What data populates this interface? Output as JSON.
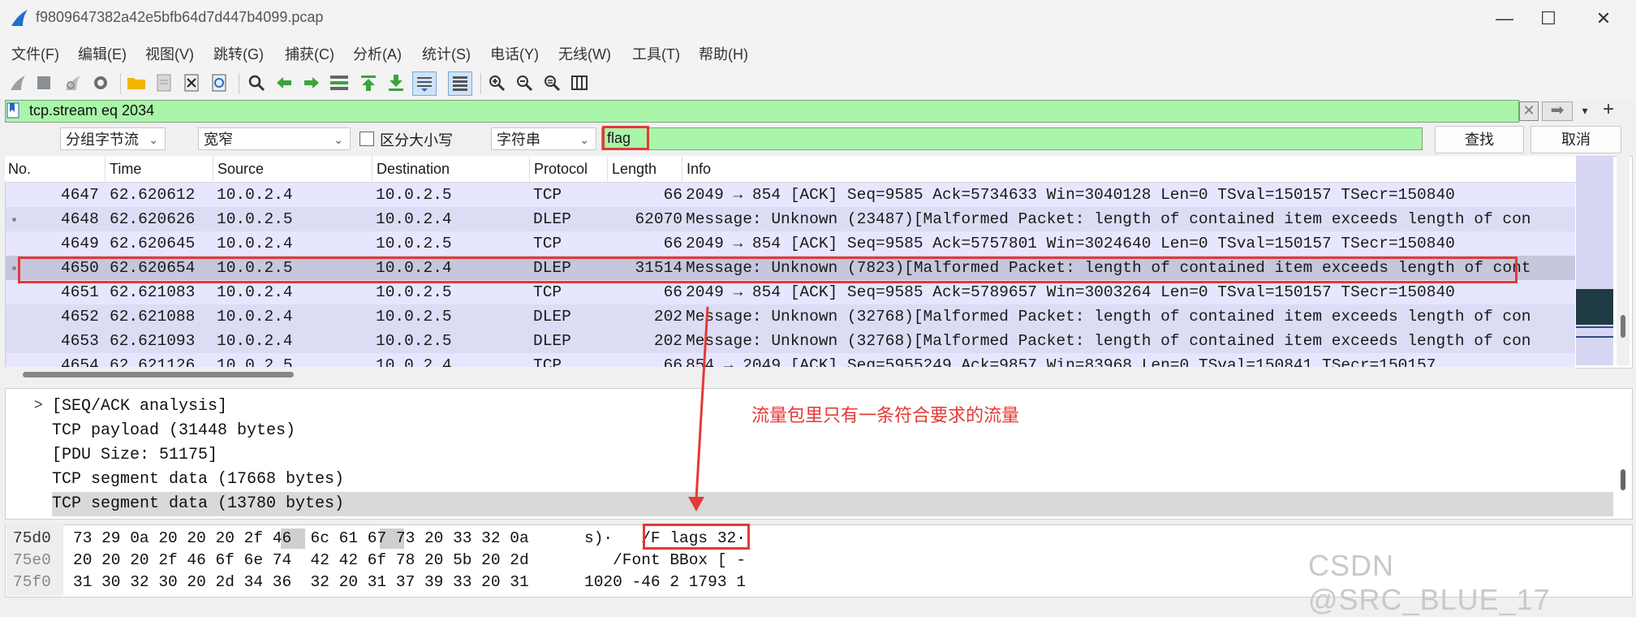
{
  "window": {
    "title": "f9809647382a42e5bfb64d7d447b4099.pcap",
    "minimize": "—",
    "maximize": "☐",
    "close": "✕"
  },
  "menu": [
    "文件(F)",
    "编辑(E)",
    "视图(V)",
    "跳转(G)",
    "捕获(C)",
    "分析(A)",
    "统计(S)",
    "电话(Y)",
    "无线(W)",
    "工具(T)",
    "帮助(H)"
  ],
  "toolbar_icons": [
    "shark-fin-start-icon",
    "stop-icon",
    "restart-icon",
    "options-gear-icon",
    "open-folder-icon",
    "save-file-icon",
    "close-file-icon",
    "reload-icon",
    "find-magnifier-icon",
    "go-back-icon",
    "go-forward-icon",
    "go-to-packet-icon",
    "first-packet-icon",
    "last-packet-icon",
    "autoscroll-icon",
    "colorize-icon",
    "zoom-in-icon",
    "zoom-out-icon",
    "zoom-reset-icon",
    "resize-columns-icon"
  ],
  "display_filter": {
    "value": "tcp.stream eq 2034",
    "color": "#a9f5a9"
  },
  "find_bar": {
    "search_in": "分组字节流",
    "char_width": "宽窄",
    "case_sensitive_label": "区分大小写",
    "search_type": "字符串",
    "search_text": "flag",
    "find_button": "查找",
    "cancel_button": "取消"
  },
  "packet_list": {
    "columns": [
      "No.",
      "Time",
      "Source",
      "Destination",
      "Protocol",
      "Length",
      "Info"
    ],
    "rows": [
      {
        "no": "4647",
        "time": "62.620612",
        "src": "10.0.2.4",
        "dst": "10.0.2.5",
        "proto": "TCP",
        "len": "66",
        "info": "2049 → 854 [ACK] Seq=9585 Ack=5734633 Win=3040128 Len=0 TSval=150157 TSecr=150840"
      },
      {
        "no": "4648",
        "time": "62.620626",
        "src": "10.0.2.5",
        "dst": "10.0.2.4",
        "proto": "DLEP",
        "len": "62070",
        "info": "Message: Unknown (23487)[Malformed Packet: length of contained item exceeds length of con"
      },
      {
        "no": "4649",
        "time": "62.620645",
        "src": "10.0.2.4",
        "dst": "10.0.2.5",
        "proto": "TCP",
        "len": "66",
        "info": "2049 → 854 [ACK] Seq=9585 Ack=5757801 Win=3024640 Len=0 TSval=150157 TSecr=150840"
      },
      {
        "no": "4650",
        "time": "62.620654",
        "src": "10.0.2.5",
        "dst": "10.0.2.4",
        "proto": "DLEP",
        "len": "31514",
        "info": "Message: Unknown (7823)[Malformed Packet: length of contained item exceeds length of cont"
      },
      {
        "no": "4651",
        "time": "62.621083",
        "src": "10.0.2.4",
        "dst": "10.0.2.5",
        "proto": "TCP",
        "len": "66",
        "info": "2049 → 854 [ACK] Seq=9585 Ack=5789657 Win=3003264 Len=0 TSval=150157 TSecr=150840"
      },
      {
        "no": "4652",
        "time": "62.621088",
        "src": "10.0.2.4",
        "dst": "10.0.2.5",
        "proto": "DLEP",
        "len": "202",
        "info": "Message: Unknown (32768)[Malformed Packet: length of contained item exceeds length of con"
      },
      {
        "no": "4653",
        "time": "62.621093",
        "src": "10.0.2.4",
        "dst": "10.0.2.5",
        "proto": "DLEP",
        "len": "202",
        "info": "Message: Unknown (32768)[Malformed Packet: length of contained item exceeds length of con"
      },
      {
        "no": "4654",
        "time": "62.621126",
        "src": "10.0.2.5",
        "dst": "10.0.2.4",
        "proto": "TCP",
        "len": "66",
        "info": "854 → 2049 [ACK] Seq=5955249 Ack=9857 Win=83968 Len=0 TSval=150841 TSecr=150157"
      }
    ]
  },
  "details": {
    "expander": ">",
    "lines": [
      "[SEQ/ACK analysis]",
      "TCP payload (31448 bytes)",
      "[PDU Size: 51175]",
      "TCP segment data (17668 bytes)",
      "TCP segment data (13780 bytes)"
    ]
  },
  "annotation": "流量包里只有一条符合要求的流量",
  "bytes": {
    "rows": [
      {
        "offset": "75d0",
        "hex": "73 29 0a 20 20 20 2f 46  6c 61 67 73 20 33 32 0a",
        "ascii": "s)·   /F lags 32·"
      },
      {
        "offset": "75e0",
        "hex": "20 20 20 2f 46 6f 6e 74  42 42 6f 78 20 5b 20 2d",
        "ascii": "   /Font BBox [ -"
      },
      {
        "offset": "75f0",
        "hex": "31 30 32 30 20 2d 34 36  32 20 31 37 39 33 20 31",
        "ascii": "1020 -46 2 1793 1"
      }
    ]
  },
  "watermark": "CSDN @SRC_BLUE_17",
  "colors": {
    "highlight_red": "#e53935",
    "tcp_row": "#e7e6ff",
    "dlep_row": "#dcdcf5",
    "selected_row": "#c6c6dc",
    "filter_green": "#a9f5a9"
  }
}
